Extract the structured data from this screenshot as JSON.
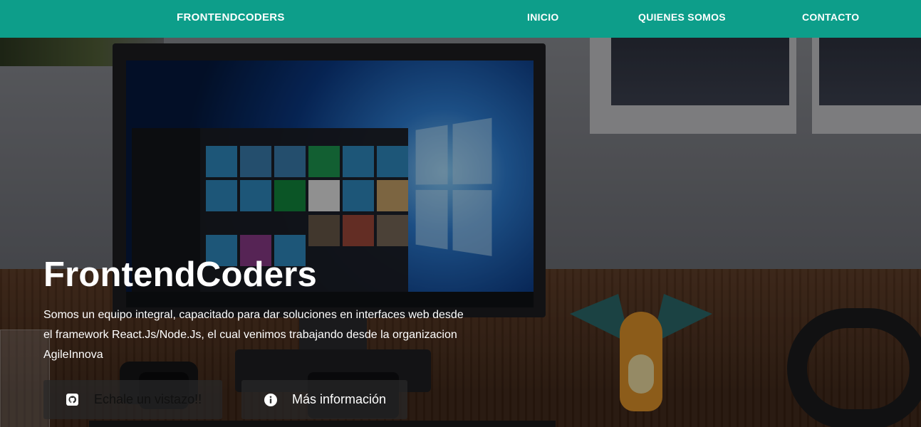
{
  "nav": {
    "brand": "FRONTENDCODERS",
    "links": [
      "INICIO",
      "QUIENES SOMOS",
      "CONTACTO"
    ]
  },
  "hero": {
    "title": "FrontendCoders",
    "description": "Somos un equipo integral, capacitado para dar soluciones en interfaces web desde el framework React.Js/Node.Js, el cual venimos trabajando desde la organizacion AgileInnova",
    "buttons": [
      {
        "label": "Echale un vistazo!!",
        "icon": "github-icon"
      },
      {
        "label": "Más información",
        "icon": "info-icon"
      }
    ]
  },
  "colors": {
    "navbar": "#0d9e8a",
    "text": "#ffffff"
  }
}
